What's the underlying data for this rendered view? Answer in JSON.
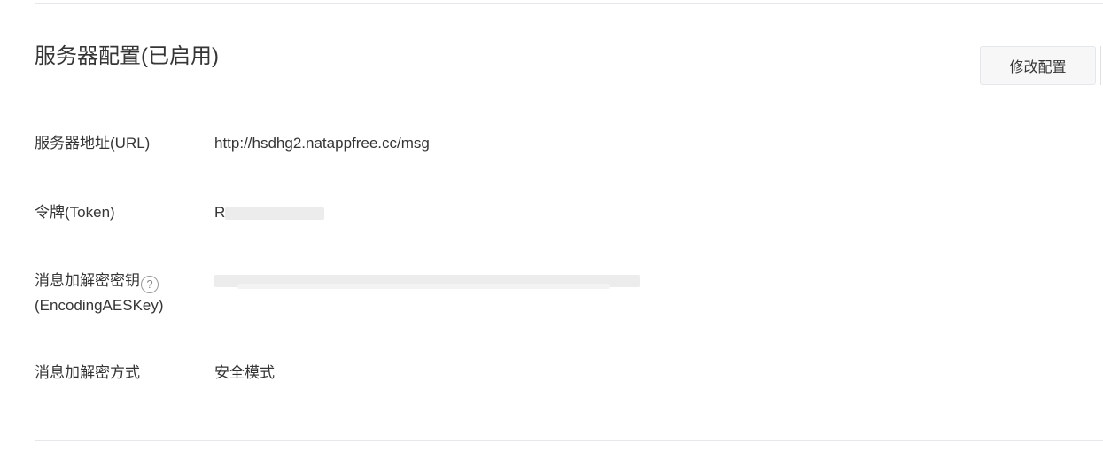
{
  "section": {
    "title": "服务器配置(已启用)",
    "edit_button_label": "修改配置"
  },
  "rows": [
    {
      "label": "服务器地址(URL)",
      "value": "http://hsdhg2.natappfree.cc/msg"
    },
    {
      "label": "令牌(Token)",
      "value": "R"
    },
    {
      "label_line1": "消息加解密密钥",
      "label_line2": "(EncodingAESKey)",
      "help_icon": "question-circle-icon",
      "value": ""
    },
    {
      "label": "消息加解密方式",
      "value": "安全模式"
    }
  ],
  "help_glyph": "?"
}
